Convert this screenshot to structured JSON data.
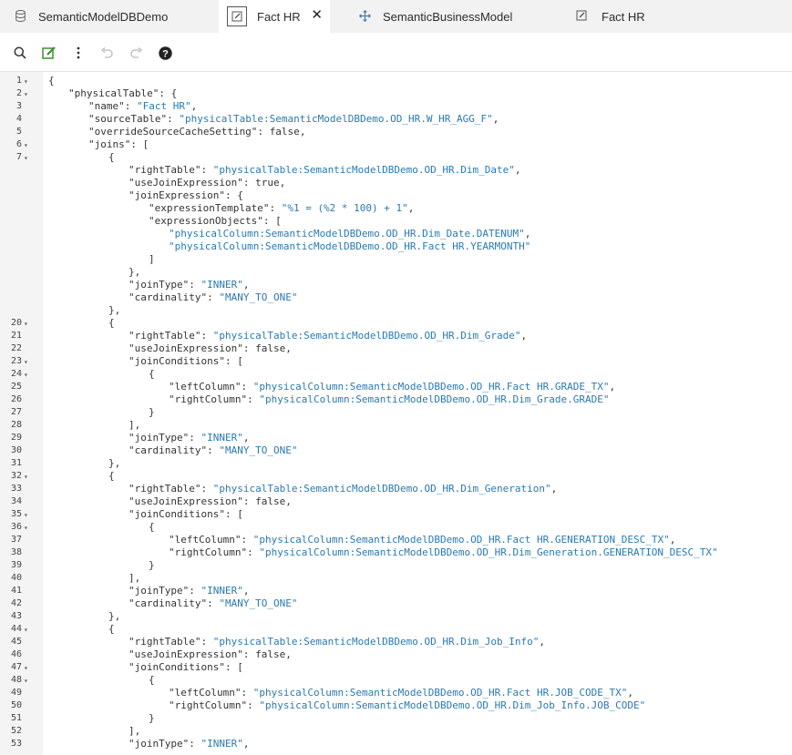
{
  "tabs": [
    {
      "label": "SemanticModelDBDemo",
      "icon": "database-icon"
    },
    {
      "label": "Fact HR",
      "icon": "edit-table-icon",
      "active": true,
      "close": "✕"
    },
    {
      "label": "SemanticBusinessModel",
      "icon": "move-arrows-icon"
    },
    {
      "label": "Fact HR",
      "icon": "edit-table-icon"
    }
  ],
  "toolbar": {
    "search": "search-icon",
    "edit": "edit-icon",
    "more": "more-vertical-icon",
    "undo": "undo-icon",
    "redo": "redo-icon",
    "help": "help-icon"
  },
  "colors": {
    "string": "#2a7ab0",
    "accent": "#3d8f32"
  },
  "code_lines": [
    {
      "n": "1",
      "fold": true,
      "ind": 0,
      "t": [
        [
          "p",
          "{"
        ]
      ]
    },
    {
      "n": "2",
      "fold": true,
      "ind": 1,
      "t": [
        [
          "k",
          "\"physicalTable\""
        ],
        [
          "p",
          ": {"
        ]
      ]
    },
    {
      "n": "3",
      "ind": 2,
      "t": [
        [
          "k",
          "\"name\""
        ],
        [
          "p",
          ": "
        ],
        [
          "s",
          "\"Fact HR\""
        ],
        [
          "p",
          ","
        ]
      ]
    },
    {
      "n": "4",
      "ind": 2,
      "t": [
        [
          "k",
          "\"sourceTable\""
        ],
        [
          "p",
          ": "
        ],
        [
          "s",
          "\"physicalTable:SemanticModelDBDemo.OD_HR.W_HR_AGG_F\""
        ],
        [
          "p",
          ","
        ]
      ]
    },
    {
      "n": "5",
      "ind": 2,
      "t": [
        [
          "k",
          "\"overrideSourceCacheSetting\""
        ],
        [
          "p",
          ": "
        ],
        [
          "lit",
          "false"
        ],
        [
          "p",
          ","
        ]
      ]
    },
    {
      "n": "6",
      "fold": true,
      "ind": 2,
      "t": [
        [
          "k",
          "\"joins\""
        ],
        [
          "p",
          ": ["
        ]
      ]
    },
    {
      "n": "7",
      "fold": true,
      "ind": 3,
      "t": [
        [
          "p",
          "{"
        ]
      ]
    },
    {
      "n": "",
      "ind": 4,
      "t": [
        [
          "k",
          "\"rightTable\""
        ],
        [
          "p",
          ": "
        ],
        [
          "s",
          "\"physicalTable:SemanticModelDBDemo.OD_HR.Dim_Date\""
        ],
        [
          "p",
          ","
        ]
      ]
    },
    {
      "n": "",
      "ind": 4,
      "t": [
        [
          "k",
          "\"useJoinExpression\""
        ],
        [
          "p",
          ": "
        ],
        [
          "lit",
          "true"
        ],
        [
          "p",
          ","
        ]
      ]
    },
    {
      "n": "",
      "ind": 4,
      "t": [
        [
          "k",
          "\"joinExpression\""
        ],
        [
          "p",
          ": {"
        ]
      ]
    },
    {
      "n": "",
      "ind": 5,
      "t": [
        [
          "k",
          "\"expressionTemplate\""
        ],
        [
          "p",
          ": "
        ],
        [
          "s",
          "\"%1 = (%2 * 100) + 1\""
        ],
        [
          "p",
          ","
        ]
      ]
    },
    {
      "n": "",
      "ind": 5,
      "t": [
        [
          "k",
          "\"expressionObjects\""
        ],
        [
          "p",
          ": ["
        ]
      ]
    },
    {
      "n": "",
      "ind": 6,
      "t": [
        [
          "s",
          "\"physicalColumn:SemanticModelDBDemo.OD_HR.Dim_Date.DATENUM\""
        ],
        [
          "p",
          ","
        ]
      ]
    },
    {
      "n": "",
      "ind": 6,
      "t": [
        [
          "s",
          "\"physicalColumn:SemanticModelDBDemo.OD_HR.Fact HR.YEARMONTH\""
        ]
      ]
    },
    {
      "n": "",
      "ind": 5,
      "t": [
        [
          "p",
          "]"
        ]
      ]
    },
    {
      "n": "",
      "ind": 4,
      "t": [
        [
          "p",
          "},"
        ]
      ]
    },
    {
      "n": "",
      "ind": 4,
      "t": [
        [
          "k",
          "\"joinType\""
        ],
        [
          "p",
          ": "
        ],
        [
          "s",
          "\"INNER\""
        ],
        [
          "p",
          ","
        ]
      ]
    },
    {
      "n": "",
      "ind": 4,
      "t": [
        [
          "k",
          "\"cardinality\""
        ],
        [
          "p",
          ": "
        ],
        [
          "s",
          "\"MANY_TO_ONE\""
        ]
      ]
    },
    {
      "n": "",
      "ind": 3,
      "t": [
        [
          "p",
          "},"
        ]
      ]
    },
    {
      "n": "20",
      "fold": true,
      "ind": 3,
      "t": [
        [
          "p",
          "{"
        ]
      ]
    },
    {
      "n": "21",
      "ind": 4,
      "t": [
        [
          "k",
          "\"rightTable\""
        ],
        [
          "p",
          ": "
        ],
        [
          "s",
          "\"physicalTable:SemanticModelDBDemo.OD_HR.Dim_Grade\""
        ],
        [
          "p",
          ","
        ]
      ]
    },
    {
      "n": "22",
      "ind": 4,
      "t": [
        [
          "k",
          "\"useJoinExpression\""
        ],
        [
          "p",
          ": "
        ],
        [
          "lit",
          "false"
        ],
        [
          "p",
          ","
        ]
      ]
    },
    {
      "n": "23",
      "fold": true,
      "ind": 4,
      "t": [
        [
          "k",
          "\"joinConditions\""
        ],
        [
          "p",
          ": ["
        ]
      ]
    },
    {
      "n": "24",
      "fold": true,
      "ind": 5,
      "t": [
        [
          "p",
          "{"
        ]
      ]
    },
    {
      "n": "25",
      "ind": 6,
      "t": [
        [
          "k",
          "\"leftColumn\""
        ],
        [
          "p",
          ": "
        ],
        [
          "s",
          "\"physicalColumn:SemanticModelDBDemo.OD_HR.Fact HR.GRADE_TX\""
        ],
        [
          "p",
          ","
        ]
      ]
    },
    {
      "n": "26",
      "ind": 6,
      "t": [
        [
          "k",
          "\"rightColumn\""
        ],
        [
          "p",
          ": "
        ],
        [
          "s",
          "\"physicalColumn:SemanticModelDBDemo.OD_HR.Dim_Grade.GRADE\""
        ]
      ]
    },
    {
      "n": "27",
      "ind": 5,
      "t": [
        [
          "p",
          "}"
        ]
      ]
    },
    {
      "n": "28",
      "ind": 4,
      "t": [
        [
          "p",
          "],"
        ]
      ]
    },
    {
      "n": "29",
      "ind": 4,
      "t": [
        [
          "k",
          "\"joinType\""
        ],
        [
          "p",
          ": "
        ],
        [
          "s",
          "\"INNER\""
        ],
        [
          "p",
          ","
        ]
      ]
    },
    {
      "n": "30",
      "ind": 4,
      "t": [
        [
          "k",
          "\"cardinality\""
        ],
        [
          "p",
          ": "
        ],
        [
          "s",
          "\"MANY_TO_ONE\""
        ]
      ]
    },
    {
      "n": "31",
      "ind": 3,
      "t": [
        [
          "p",
          "},"
        ]
      ]
    },
    {
      "n": "32",
      "fold": true,
      "ind": 3,
      "t": [
        [
          "p",
          "{"
        ]
      ]
    },
    {
      "n": "33",
      "ind": 4,
      "t": [
        [
          "k",
          "\"rightTable\""
        ],
        [
          "p",
          ": "
        ],
        [
          "s",
          "\"physicalTable:SemanticModelDBDemo.OD_HR.Dim_Generation\""
        ],
        [
          "p",
          ","
        ]
      ]
    },
    {
      "n": "34",
      "ind": 4,
      "t": [
        [
          "k",
          "\"useJoinExpression\""
        ],
        [
          "p",
          ": "
        ],
        [
          "lit",
          "false"
        ],
        [
          "p",
          ","
        ]
      ]
    },
    {
      "n": "35",
      "fold": true,
      "ind": 4,
      "t": [
        [
          "k",
          "\"joinConditions\""
        ],
        [
          "p",
          ": ["
        ]
      ]
    },
    {
      "n": "36",
      "fold": true,
      "ind": 5,
      "t": [
        [
          "p",
          "{"
        ]
      ]
    },
    {
      "n": "37",
      "ind": 6,
      "t": [
        [
          "k",
          "\"leftColumn\""
        ],
        [
          "p",
          ": "
        ],
        [
          "s",
          "\"physicalColumn:SemanticModelDBDemo.OD_HR.Fact HR.GENERATION_DESC_TX\""
        ],
        [
          "p",
          ","
        ]
      ]
    },
    {
      "n": "38",
      "ind": 6,
      "t": [
        [
          "k",
          "\"rightColumn\""
        ],
        [
          "p",
          ": "
        ],
        [
          "s",
          "\"physicalColumn:SemanticModelDBDemo.OD_HR.Dim_Generation.GENERATION_DESC_TX\""
        ]
      ]
    },
    {
      "n": "39",
      "ind": 5,
      "t": [
        [
          "p",
          "}"
        ]
      ]
    },
    {
      "n": "40",
      "ind": 4,
      "t": [
        [
          "p",
          "],"
        ]
      ]
    },
    {
      "n": "41",
      "ind": 4,
      "t": [
        [
          "k",
          "\"joinType\""
        ],
        [
          "p",
          ": "
        ],
        [
          "s",
          "\"INNER\""
        ],
        [
          "p",
          ","
        ]
      ]
    },
    {
      "n": "42",
      "ind": 4,
      "t": [
        [
          "k",
          "\"cardinality\""
        ],
        [
          "p",
          ": "
        ],
        [
          "s",
          "\"MANY_TO_ONE\""
        ]
      ]
    },
    {
      "n": "43",
      "ind": 3,
      "t": [
        [
          "p",
          "},"
        ]
      ]
    },
    {
      "n": "44",
      "fold": true,
      "ind": 3,
      "t": [
        [
          "p",
          "{"
        ]
      ]
    },
    {
      "n": "45",
      "ind": 4,
      "t": [
        [
          "k",
          "\"rightTable\""
        ],
        [
          "p",
          ": "
        ],
        [
          "s",
          "\"physicalTable:SemanticModelDBDemo.OD_HR.Dim_Job_Info\""
        ],
        [
          "p",
          ","
        ]
      ]
    },
    {
      "n": "46",
      "ind": 4,
      "t": [
        [
          "k",
          "\"useJoinExpression\""
        ],
        [
          "p",
          ": "
        ],
        [
          "lit",
          "false"
        ],
        [
          "p",
          ","
        ]
      ]
    },
    {
      "n": "47",
      "fold": true,
      "ind": 4,
      "t": [
        [
          "k",
          "\"joinConditions\""
        ],
        [
          "p",
          ": ["
        ]
      ]
    },
    {
      "n": "48",
      "fold": true,
      "ind": 5,
      "t": [
        [
          "p",
          "{"
        ]
      ]
    },
    {
      "n": "49",
      "ind": 6,
      "t": [
        [
          "k",
          "\"leftColumn\""
        ],
        [
          "p",
          ": "
        ],
        [
          "s",
          "\"physicalColumn:SemanticModelDBDemo.OD_HR.Fact HR.JOB_CODE_TX\""
        ],
        [
          "p",
          ","
        ]
      ]
    },
    {
      "n": "50",
      "ind": 6,
      "t": [
        [
          "k",
          "\"rightColumn\""
        ],
        [
          "p",
          ": "
        ],
        [
          "s",
          "\"physicalColumn:SemanticModelDBDemo.OD_HR.Dim_Job_Info.JOB_CODE\""
        ]
      ]
    },
    {
      "n": "51",
      "ind": 5,
      "t": [
        [
          "p",
          "}"
        ]
      ]
    },
    {
      "n": "52",
      "ind": 4,
      "t": [
        [
          "p",
          "],"
        ]
      ]
    },
    {
      "n": "53",
      "ind": 4,
      "t": [
        [
          "k",
          "\"joinType\""
        ],
        [
          "p",
          ": "
        ],
        [
          "s",
          "\"INNER\""
        ],
        [
          "p",
          ","
        ]
      ]
    }
  ]
}
